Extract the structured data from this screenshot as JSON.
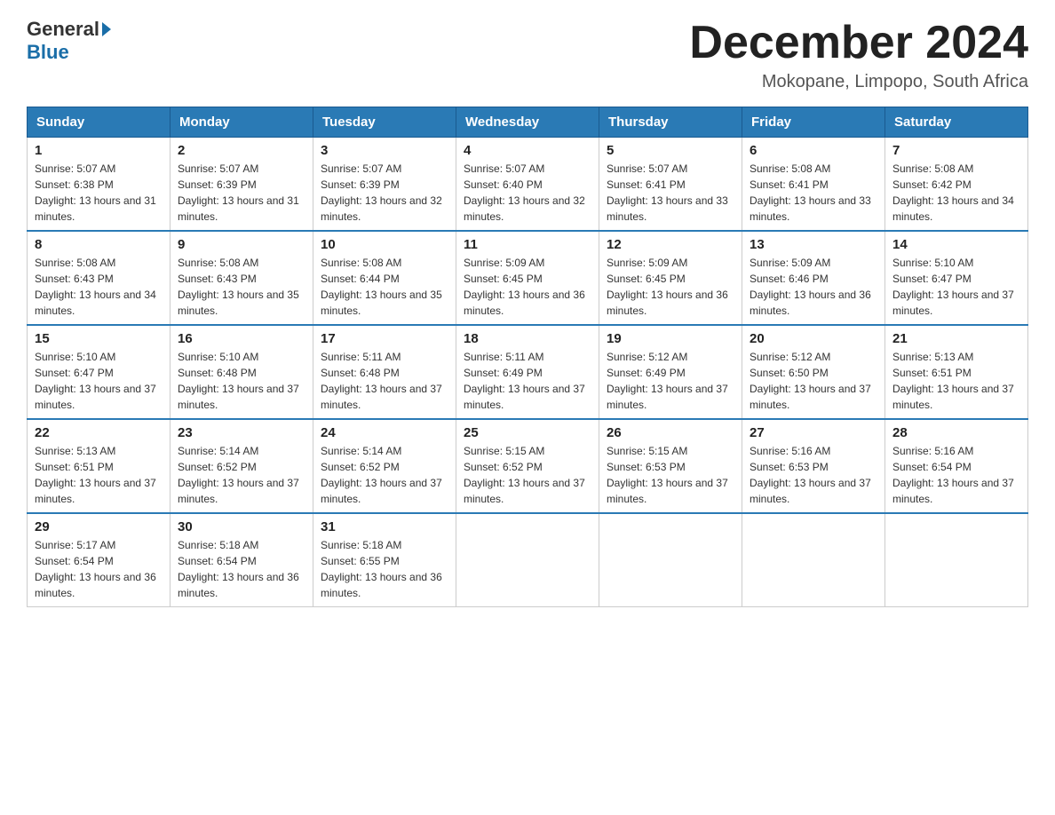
{
  "header": {
    "logo_general": "General",
    "logo_blue": "Blue",
    "month_title": "December 2024",
    "location": "Mokopane, Limpopo, South Africa"
  },
  "weekdays": [
    "Sunday",
    "Monday",
    "Tuesday",
    "Wednesday",
    "Thursday",
    "Friday",
    "Saturday"
  ],
  "weeks": [
    [
      {
        "day": 1,
        "sunrise": "5:07 AM",
        "sunset": "6:38 PM",
        "daylight": "13 hours and 31 minutes."
      },
      {
        "day": 2,
        "sunrise": "5:07 AM",
        "sunset": "6:39 PM",
        "daylight": "13 hours and 31 minutes."
      },
      {
        "day": 3,
        "sunrise": "5:07 AM",
        "sunset": "6:39 PM",
        "daylight": "13 hours and 32 minutes."
      },
      {
        "day": 4,
        "sunrise": "5:07 AM",
        "sunset": "6:40 PM",
        "daylight": "13 hours and 32 minutes."
      },
      {
        "day": 5,
        "sunrise": "5:07 AM",
        "sunset": "6:41 PM",
        "daylight": "13 hours and 33 minutes."
      },
      {
        "day": 6,
        "sunrise": "5:08 AM",
        "sunset": "6:41 PM",
        "daylight": "13 hours and 33 minutes."
      },
      {
        "day": 7,
        "sunrise": "5:08 AM",
        "sunset": "6:42 PM",
        "daylight": "13 hours and 34 minutes."
      }
    ],
    [
      {
        "day": 8,
        "sunrise": "5:08 AM",
        "sunset": "6:43 PM",
        "daylight": "13 hours and 34 minutes."
      },
      {
        "day": 9,
        "sunrise": "5:08 AM",
        "sunset": "6:43 PM",
        "daylight": "13 hours and 35 minutes."
      },
      {
        "day": 10,
        "sunrise": "5:08 AM",
        "sunset": "6:44 PM",
        "daylight": "13 hours and 35 minutes."
      },
      {
        "day": 11,
        "sunrise": "5:09 AM",
        "sunset": "6:45 PM",
        "daylight": "13 hours and 36 minutes."
      },
      {
        "day": 12,
        "sunrise": "5:09 AM",
        "sunset": "6:45 PM",
        "daylight": "13 hours and 36 minutes."
      },
      {
        "day": 13,
        "sunrise": "5:09 AM",
        "sunset": "6:46 PM",
        "daylight": "13 hours and 36 minutes."
      },
      {
        "day": 14,
        "sunrise": "5:10 AM",
        "sunset": "6:47 PM",
        "daylight": "13 hours and 37 minutes."
      }
    ],
    [
      {
        "day": 15,
        "sunrise": "5:10 AM",
        "sunset": "6:47 PM",
        "daylight": "13 hours and 37 minutes."
      },
      {
        "day": 16,
        "sunrise": "5:10 AM",
        "sunset": "6:48 PM",
        "daylight": "13 hours and 37 minutes."
      },
      {
        "day": 17,
        "sunrise": "5:11 AM",
        "sunset": "6:48 PM",
        "daylight": "13 hours and 37 minutes."
      },
      {
        "day": 18,
        "sunrise": "5:11 AM",
        "sunset": "6:49 PM",
        "daylight": "13 hours and 37 minutes."
      },
      {
        "day": 19,
        "sunrise": "5:12 AM",
        "sunset": "6:49 PM",
        "daylight": "13 hours and 37 minutes."
      },
      {
        "day": 20,
        "sunrise": "5:12 AM",
        "sunset": "6:50 PM",
        "daylight": "13 hours and 37 minutes."
      },
      {
        "day": 21,
        "sunrise": "5:13 AM",
        "sunset": "6:51 PM",
        "daylight": "13 hours and 37 minutes."
      }
    ],
    [
      {
        "day": 22,
        "sunrise": "5:13 AM",
        "sunset": "6:51 PM",
        "daylight": "13 hours and 37 minutes."
      },
      {
        "day": 23,
        "sunrise": "5:14 AM",
        "sunset": "6:52 PM",
        "daylight": "13 hours and 37 minutes."
      },
      {
        "day": 24,
        "sunrise": "5:14 AM",
        "sunset": "6:52 PM",
        "daylight": "13 hours and 37 minutes."
      },
      {
        "day": 25,
        "sunrise": "5:15 AM",
        "sunset": "6:52 PM",
        "daylight": "13 hours and 37 minutes."
      },
      {
        "day": 26,
        "sunrise": "5:15 AM",
        "sunset": "6:53 PM",
        "daylight": "13 hours and 37 minutes."
      },
      {
        "day": 27,
        "sunrise": "5:16 AM",
        "sunset": "6:53 PM",
        "daylight": "13 hours and 37 minutes."
      },
      {
        "day": 28,
        "sunrise": "5:16 AM",
        "sunset": "6:54 PM",
        "daylight": "13 hours and 37 minutes."
      }
    ],
    [
      {
        "day": 29,
        "sunrise": "5:17 AM",
        "sunset": "6:54 PM",
        "daylight": "13 hours and 36 minutes."
      },
      {
        "day": 30,
        "sunrise": "5:18 AM",
        "sunset": "6:54 PM",
        "daylight": "13 hours and 36 minutes."
      },
      {
        "day": 31,
        "sunrise": "5:18 AM",
        "sunset": "6:55 PM",
        "daylight": "13 hours and 36 minutes."
      },
      null,
      null,
      null,
      null
    ]
  ]
}
